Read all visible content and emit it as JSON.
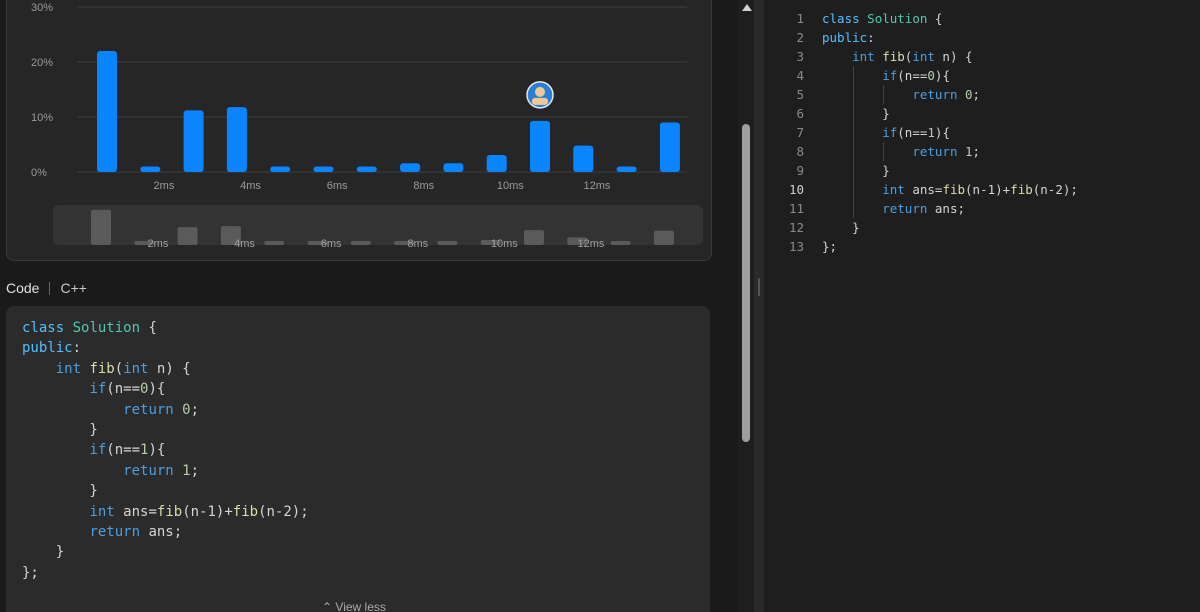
{
  "chart_data": {
    "type": "bar",
    "y_ticks": [
      "30%",
      "20%",
      "10%",
      "0%"
    ],
    "x_ticks": [
      "2ms",
      "4ms",
      "6ms",
      "8ms",
      "10ms",
      "12ms"
    ],
    "ylim": [
      0,
      30
    ],
    "values": [
      22,
      1,
      11.2,
      11.8,
      1,
      1,
      1,
      1.6,
      1.6,
      3.1,
      9.3,
      4.8,
      1,
      9
    ],
    "highlight_index": 10,
    "colors": {
      "bar": "#0a84ff",
      "mini_bar": "#5a5a5a",
      "grid": "#3d3d3d"
    }
  },
  "code_section": {
    "title": "Code",
    "language": "C++",
    "view_less": "View less"
  },
  "code_lines": [
    "class Solution {",
    "public:",
    "    int fib(int n) {",
    "        if(n==0){",
    "            return 0;",
    "        }",
    "        if(n==1){",
    "            return 1;",
    "        }",
    "        int ans=fib(n-1)+fib(n-2);",
    "        return ans;",
    "    }",
    "};"
  ],
  "editor": {
    "line_numbers": [
      "1",
      "2",
      "3",
      "4",
      "5",
      "6",
      "7",
      "8",
      "9",
      "10",
      "11",
      "12",
      "13"
    ],
    "active_line": 10
  },
  "icons": {
    "scroll_up": "triangle-up-icon",
    "view_less": "double-chevron-up-icon",
    "avatar": "user-avatar"
  }
}
